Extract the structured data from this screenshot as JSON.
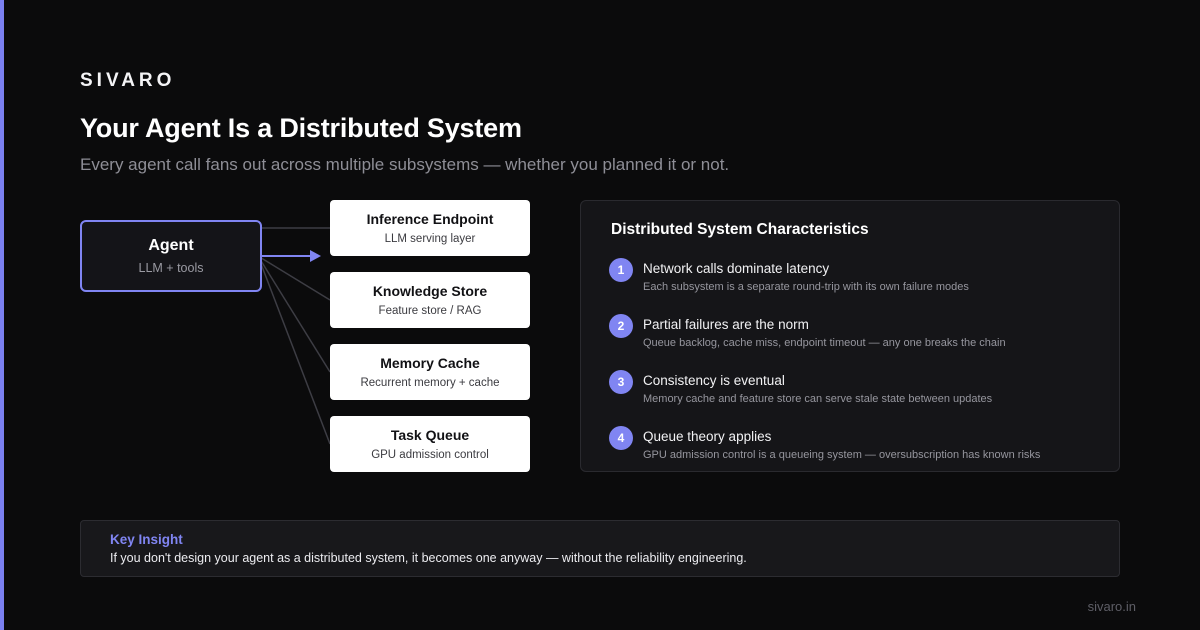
{
  "brand": "SIVARO",
  "title": "Your Agent Is a Distributed System",
  "subtitle": "Every agent call fans out across multiple subsystems — whether you planned it or not.",
  "agent": {
    "title": "Agent",
    "subtitle": "LLM + tools"
  },
  "subsystems": [
    {
      "title": "Inference Endpoint",
      "desc": "LLM serving layer"
    },
    {
      "title": "Knowledge Store",
      "desc": "Feature store / RAG"
    },
    {
      "title": "Memory Cache",
      "desc": "Recurrent memory + cache"
    },
    {
      "title": "Task Queue",
      "desc": "GPU admission control"
    }
  ],
  "panel": {
    "title": "Distributed System Characteristics",
    "items": [
      {
        "num": "1",
        "title": "Network calls dominate latency",
        "desc": "Each subsystem is a separate round-trip with its own failure modes"
      },
      {
        "num": "2",
        "title": "Partial failures are the norm",
        "desc": "Queue backlog, cache miss, endpoint timeout — any one breaks the chain"
      },
      {
        "num": "3",
        "title": "Consistency is eventual",
        "desc": "Memory cache and feature store can serve stale state between updates"
      },
      {
        "num": "4",
        "title": "Queue theory applies",
        "desc": "GPU admission control is a queueing system — oversubscription has known risks"
      }
    ]
  },
  "insight": {
    "label": "Key Insight",
    "text": "If you don't design your agent as a distributed system, it becomes one anyway — without the reliability engineering."
  },
  "footer": "sivaro.in",
  "colors": {
    "accent": "#8085f2",
    "background": "#0b0b0c",
    "panel": "#151518"
  }
}
